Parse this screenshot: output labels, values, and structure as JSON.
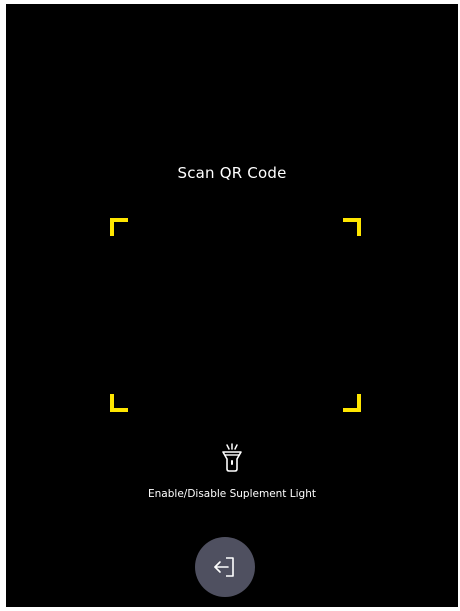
{
  "scanner": {
    "title": "Scan QR Code",
    "frame_color": "#ffe600",
    "background_color": "#000000"
  },
  "light": {
    "icon": "flashlight-icon",
    "label": "Enable/Disable Suplement Light"
  },
  "exit": {
    "icon": "exit-icon",
    "button_color": "#4f5060"
  }
}
